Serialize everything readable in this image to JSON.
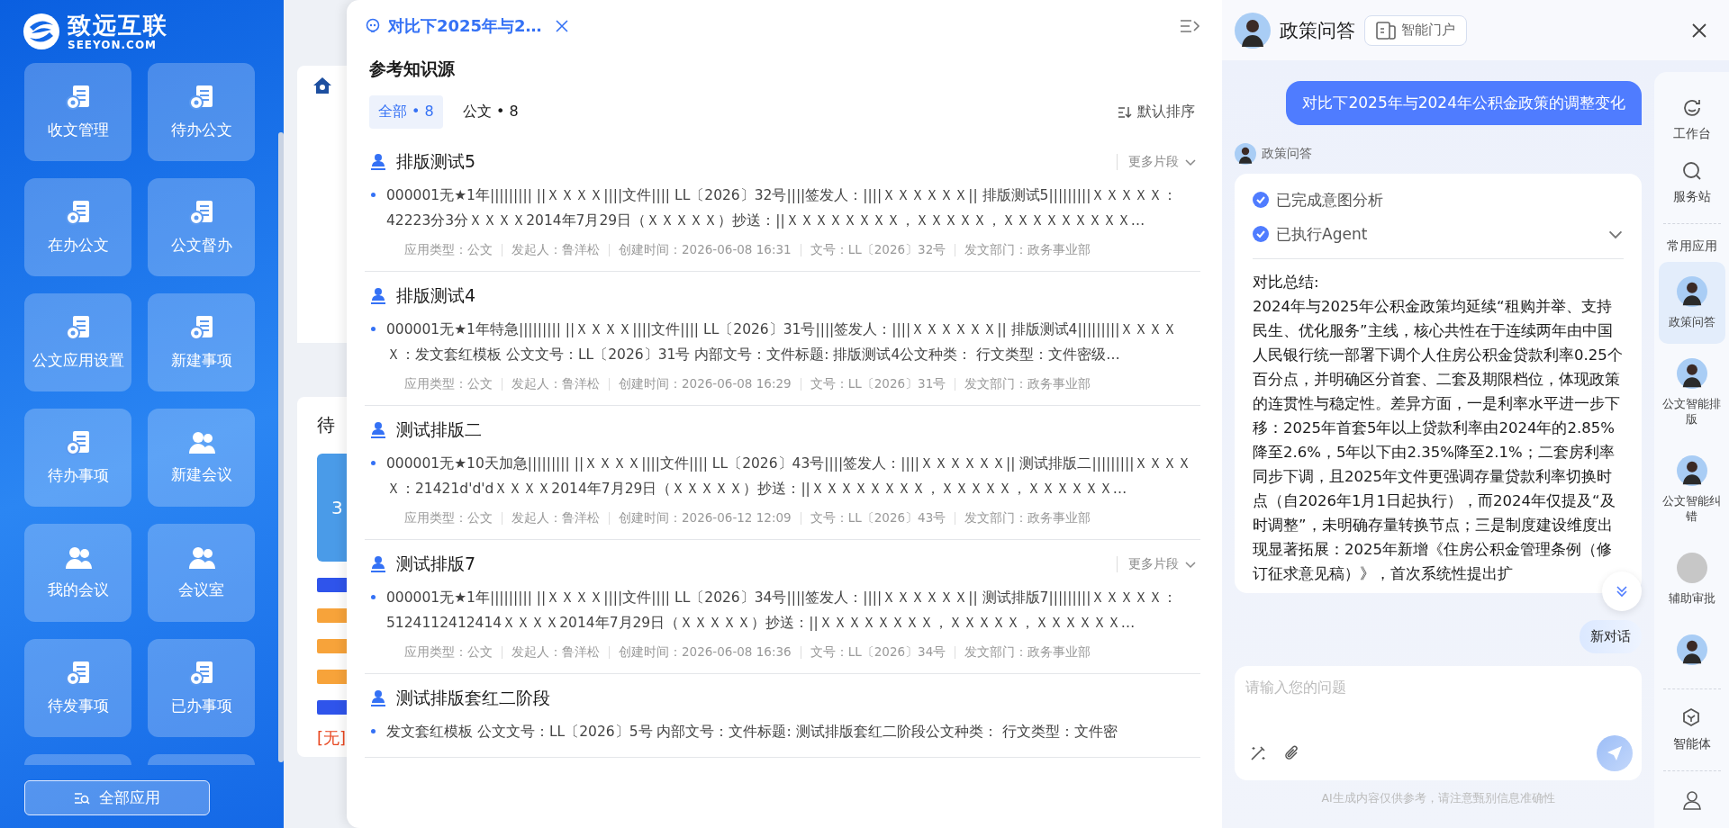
{
  "sidebar": {
    "logo": {
      "name": "致远互联",
      "domain": "SEEYON.COM"
    },
    "tiles": [
      {
        "label": "收文管理",
        "kind": "document"
      },
      {
        "label": "待办公文",
        "kind": "document"
      },
      {
        "label": "在办公文",
        "kind": "document"
      },
      {
        "label": "公文督办",
        "kind": "document"
      },
      {
        "label": "公文应用设置",
        "kind": "document"
      },
      {
        "label": "新建事项",
        "kind": "document"
      },
      {
        "label": "待办事项",
        "kind": "document"
      },
      {
        "label": "新建会议",
        "kind": "people"
      },
      {
        "label": "我的会议",
        "kind": "people"
      },
      {
        "label": "会议室",
        "kind": "people"
      },
      {
        "label": "待发事项",
        "kind": "document"
      },
      {
        "label": "已办事项",
        "kind": "document"
      }
    ],
    "all_apps": "全部应用"
  },
  "background_page": {
    "heading": "待",
    "count": "3",
    "tags": [
      {
        "color": "#2f54eb"
      },
      {
        "color": "#f7a33a"
      },
      {
        "color": "#f7a33a"
      },
      {
        "color": "#f7a33a"
      },
      {
        "color": "#2f54eb"
      }
    ],
    "note": "[无]"
  },
  "source_panel": {
    "tab_title": "对比下2025年与2…",
    "title": "参考知识源",
    "filters": [
      {
        "label": "全部 • 8",
        "selected": true
      },
      {
        "label": "公文 • 8",
        "selected": false
      }
    ],
    "sort": "默认排序",
    "items": [
      {
        "title": "排版测试5",
        "more": "更多片段",
        "snippet": "000001无★1年||||||||| ||ＸＸＸＸ||||文件|||| LL〔2026〕32号||||签发人：||||ＸＸＸＸＸＸ|| 排版测试5|||||||||ＸＸＸＸＸ：42223分3分ＸＸＸＸ2014年7月29日（ＸＸＸＸＸ）抄送：||ＸＸＸＸＸＸＸＸ，ＸＸＸＸＸ，ＸＸＸＸＸＸＸＸＸ…",
        "meta": [
          "应用类型：公文",
          "发起人：鲁洋松",
          "创建时间：2026-06-08 16:31",
          "文号：LL〔2026〕32号",
          "发文部门：政务事业部"
        ]
      },
      {
        "title": "排版测试4",
        "snippet": "000001无★1年特急||||||||| ||ＸＸＸＸ||||文件|||| LL〔2026〕31号||||签发人：||||ＸＸＸＸＸＸ|| 排版测试4|||||||||ＸＸＸＸＸ：发文套红模板 公文文号：LL〔2026〕31号 内部文号：文件标题: 排版测试4公文种类： 行文类型：文件密级…",
        "meta": [
          "应用类型：公文",
          "发起人：鲁洋松",
          "创建时间：2026-06-08 16:29",
          "文号：LL〔2026〕31号",
          "发文部门：政务事业部"
        ]
      },
      {
        "title": "测试排版二",
        "snippet": "000001无★10天加急||||||||| ||ＸＸＸＸ||||文件|||| LL〔2026〕43号||||签发人：||||ＸＸＸＸＸＸ|| 测试排版二|||||||||ＸＸＸＸＸ：21421d'd'dＸＸＸＸ2014年7月29日（ＸＸＸＸＸ）抄送：||ＸＸＸＸＸＸＸＸ，ＸＸＸＸＸ，ＸＸＸＸＸＸ…",
        "meta": [
          "应用类型：公文",
          "发起人：鲁洋松",
          "创建时间：2026-06-12 12:09",
          "文号：LL〔2026〕43号",
          "发文部门：政务事业部"
        ]
      },
      {
        "title": "测试排版7",
        "more": "更多片段",
        "snippet": "000001无★1年||||||||| ||ＸＸＸＸ||||文件|||| LL〔2026〕34号||||签发人：||||ＸＸＸＸＸＸ|| 测试排版7|||||||||ＸＸＸＸＸ：5124112412414ＸＸＸＸ2014年7月29日（ＸＸＸＸＸ）抄送：||ＸＸＸＸＸＸＸＸ，ＸＸＸＸＸ，ＸＸＸＸＸＸ…",
        "meta": [
          "应用类型：公文",
          "发起人：鲁洋松",
          "创建时间：2026-06-08 16:36",
          "文号：LL〔2026〕34号",
          "发文部门：政务事业部"
        ]
      },
      {
        "title": "测试排版套红二阶段",
        "snippet": "发文套红模板 公文文号：LL〔2026〕5号 内部文号：文件标题: 测试排版套红二阶段公文种类： 行文类型：文件密"
      }
    ]
  },
  "chat": {
    "title": "政策问答",
    "portal": "智能门户",
    "question": "对比下2025年与2024年公积金政策的调整变化",
    "bot_name": "政策问答",
    "steps": [
      {
        "label": "已完成意图分析",
        "done": true
      },
      {
        "label": "已执行Agent",
        "done": true,
        "expandable": true
      }
    ],
    "answer_heading": "对比总结:",
    "answer": "2024年与2025年公积金政策均延续“租购并举、支持民生、优化服务”主线，核心共性在于连续两年由中国人民银行统一部署下调个人住房公积金贷款利率0.25个百分点，并明确区分首套、二套及期限档位，体现政策的连贯性与稳定性。差异方面，一是利率水平进一步下移：2025年首套5年以上贷款利率由2024年的2.85%降至2.6%，5年以下由2.35%降至2.1%；二套房利率同步下调，且2025年文件更强调存量贷款利率切换时点（自2026年1月1日起执行），而2024年仅提及“及时调整”，未明确存量转换节点；三是制度建设维度出现显著拓展：2025年新增《住房公积金管理条例（修订征求意见稿）》，首次系统性提出扩",
    "new_chat": "新对话",
    "input_placeholder": "请输入您的问题",
    "disclaimer": "AI生成内容仅供参考，请注意甄别信息准确性"
  },
  "rail": {
    "top": [
      {
        "label": "工作台",
        "kind": "workbench"
      },
      {
        "label": "服务站",
        "kind": "search"
      }
    ],
    "section": "常用应用",
    "apps": [
      {
        "label": "政策问答",
        "kind": "person",
        "selected": true
      },
      {
        "label": "公文智能排版",
        "kind": "person",
        "selected": false
      },
      {
        "label": "公文智能纠错",
        "kind": "person",
        "selected": false
      },
      {
        "label": "辅助审批",
        "kind": "blank",
        "selected": false
      },
      {
        "kind": "person",
        "selected": false
      }
    ],
    "agents": "智能体"
  }
}
